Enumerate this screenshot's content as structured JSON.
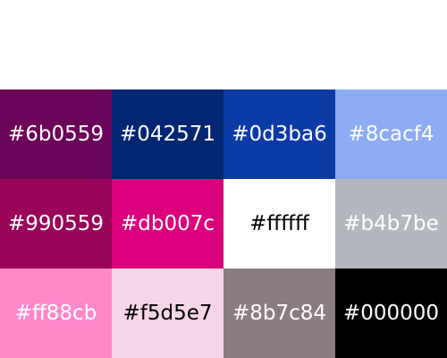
{
  "palette": {
    "swatches": [
      {
        "label": "#6b0559",
        "color": "#6b0559",
        "text_color": "#ffffff"
      },
      {
        "label": "#042571",
        "color": "#042571",
        "text_color": "#ffffff"
      },
      {
        "label": "#0d3ba6",
        "color": "#0d3ba6",
        "text_color": "#ffffff"
      },
      {
        "label": "#8cacf4",
        "color": "#8cacf4",
        "text_color": "#ffffff"
      },
      {
        "label": "#990559",
        "color": "#990559",
        "text_color": "#ffffff"
      },
      {
        "label": "#db007c",
        "color": "#db007c",
        "text_color": "#ffffff"
      },
      {
        "label": "#ffffff",
        "color": "#ffffff",
        "text_color": "#000000"
      },
      {
        "label": "#b4b7be",
        "color": "#b4b7be",
        "text_color": "#ffffff"
      },
      {
        "label": "#ff88cb",
        "color": "#ff88cb",
        "text_color": "#ffffff"
      },
      {
        "label": "#f5d5e7",
        "color": "#f5d5e7",
        "text_color": "#000000"
      },
      {
        "label": "#8b7c84",
        "color": "#8b7c84",
        "text_color": "#ffffff"
      },
      {
        "label": "#000000",
        "color": "#000000",
        "text_color": "#ffffff"
      }
    ]
  }
}
